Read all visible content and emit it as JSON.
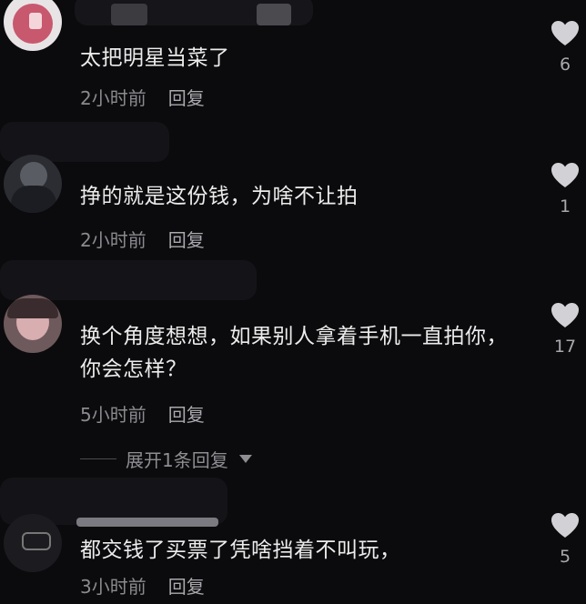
{
  "comments": [
    {
      "text": "太把明星当菜了",
      "time": "2小时前",
      "reply": "回复",
      "likes": "6",
      "avatar_color": "#c8586e"
    },
    {
      "text": "挣的就是这份钱，为啥不让拍",
      "time": "2小时前",
      "reply": "回复",
      "likes": "1",
      "avatar_color": "#3a3c44"
    },
    {
      "text": "换个角度想想，如果别人拿着手机一直拍你，你会怎样？",
      "time": "5小时前",
      "reply": "回复",
      "likes": "17",
      "avatar_color": "#b8868a"
    },
    {
      "text": "都交钱了买票了凭啥挡着不叫玩，",
      "time": "3小时前",
      "reply": "回复",
      "likes": "5",
      "avatar_color": "#1c1c20"
    }
  ],
  "expand_replies": "展开1条回复",
  "icons": {
    "like": "heart-icon",
    "expand": "caret-down-icon"
  },
  "colors": {
    "background": "#0b0b0d",
    "text": "#ececec",
    "meta": "#8a8a8f",
    "heart": "#d2d2d6"
  }
}
